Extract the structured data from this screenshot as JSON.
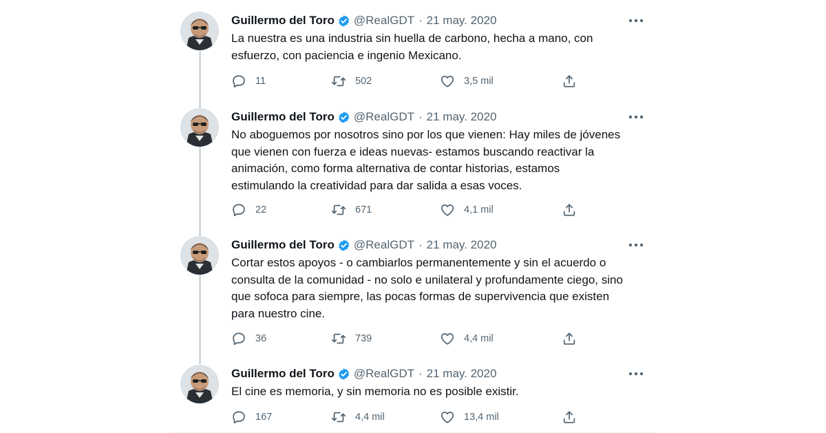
{
  "colors": {
    "text_primary": "#0f1419",
    "text_secondary": "#536471",
    "verified_badge": "#1d9bf0",
    "thread_line": "#cfd9de",
    "background": "#ffffff"
  },
  "icons": {
    "verified": "verified-badge-icon",
    "more": "more-options-icon",
    "reply": "reply-icon",
    "retweet": "retweet-icon",
    "like": "heart-icon",
    "share": "share-icon"
  },
  "tweets": [
    {
      "author_name": "Guillermo del Toro",
      "handle": "@RealGDT",
      "separator": "·",
      "date": "21 may. 2020",
      "text_lines": [
        "La nuestra es una industria sin huella de carbono, hecha a mano, con",
        "esfuerzo, con paciencia e ingenio Mexicano."
      ],
      "replies": "11",
      "retweets": "502",
      "likes": "3,5 mil"
    },
    {
      "author_name": "Guillermo del Toro",
      "handle": "@RealGDT",
      "separator": "·",
      "date": "21 may. 2020",
      "text_lines": [
        "No aboguemos por nosotros sino por los que vienen: Hay miles de jóvenes",
        "que vienen con fuerza e ideas nuevas-  estamos buscando reactivar la",
        "animación, como forma alternativa de contar historias, estamos",
        "estimulando la creatividad para dar salida a esas voces."
      ],
      "replies": "22",
      "retweets": "671",
      "likes": "4,1 mil"
    },
    {
      "author_name": "Guillermo del Toro",
      "handle": "@RealGDT",
      "separator": "·",
      "date": "21 may. 2020",
      "text_lines": [
        "Cortar estos apoyos - o cambiarlos permanentemente y sin el acuerdo o",
        "consulta de la comunidad - no solo e unilateral y profundamente ciego, sino",
        "que sofoca para siempre, las pocas formas de supervivencia que existen",
        "para nuestro cine."
      ],
      "replies": "36",
      "retweets": "739",
      "likes": "4,4 mil"
    },
    {
      "author_name": "Guillermo del Toro",
      "handle": "@RealGDT",
      "separator": "·",
      "date": "21 may. 2020",
      "text_lines": [
        "El cine es memoria, y sin memoria no es posible existir."
      ],
      "replies": "167",
      "retweets": "4,4 mil",
      "likes": "13,4 mil"
    }
  ]
}
